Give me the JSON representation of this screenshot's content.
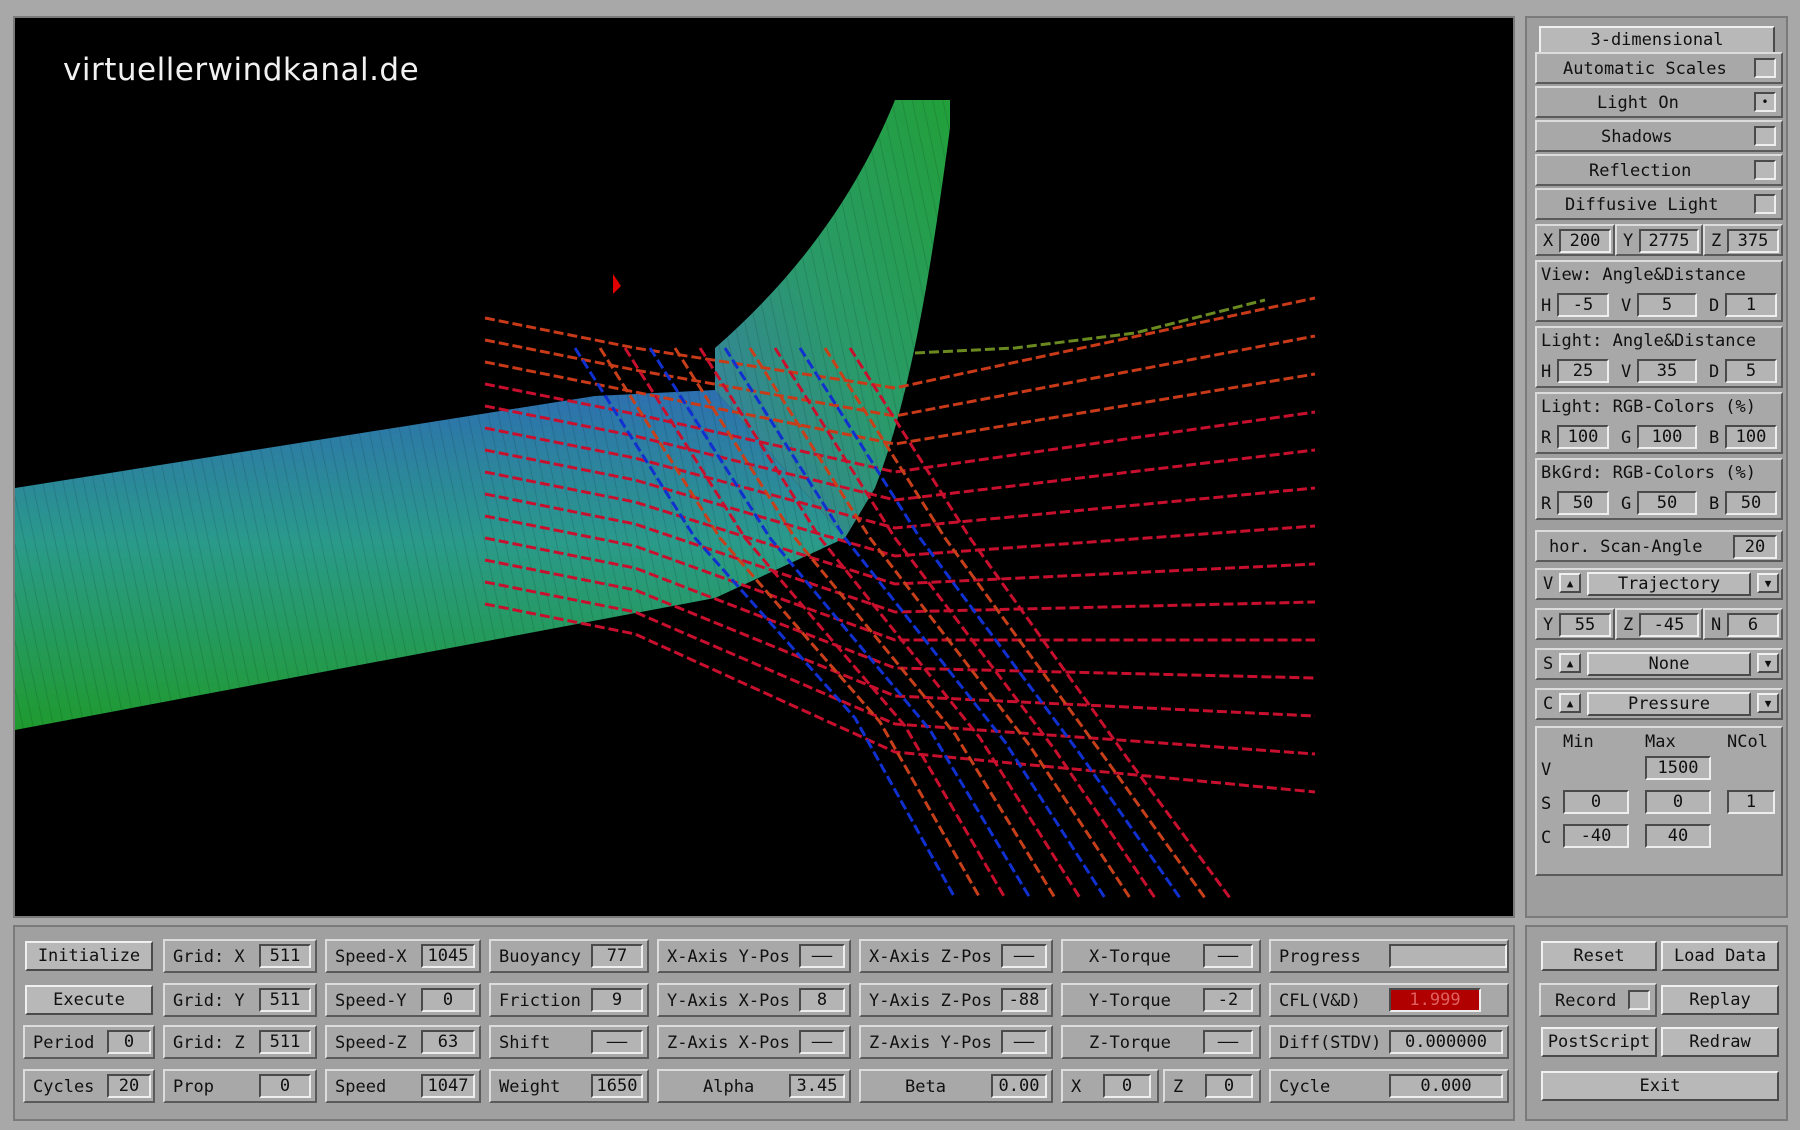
{
  "viewport": {
    "watermark": "virtuellerwindkanal.de"
  },
  "right_panel": {
    "mode_button": "3-dimensional",
    "toggles": [
      {
        "label": "Automatic Scales",
        "checked": false
      },
      {
        "label": "Light On",
        "checked": true
      },
      {
        "label": "Shadows",
        "checked": false
      },
      {
        "label": "Reflection",
        "checked": false
      },
      {
        "label": "Diffusive Light",
        "checked": false
      }
    ],
    "position": {
      "x_label": "X",
      "x": "200",
      "y_label": "Y",
      "y": "2775",
      "z_label": "Z",
      "z": "375"
    },
    "view": {
      "title": "View:  Angle&Distance",
      "h_label": "H",
      "h": "-5",
      "v_label": "V",
      "v": "5",
      "d_label": "D",
      "d": "1"
    },
    "light_angle": {
      "title": "Light: Angle&Distance",
      "h_label": "H",
      "h": "25",
      "v_label": "V",
      "v": "35",
      "d_label": "D",
      "d": "5"
    },
    "light_rgb": {
      "title": "Light: RGB-Colors (%)",
      "r_label": "R",
      "r": "100",
      "g_label": "G",
      "g": "100",
      "b_label": "B",
      "b": "100"
    },
    "bkgrd_rgb": {
      "title": "BkGrd: RGB-Colors (%)",
      "r_label": "R",
      "r": "50",
      "g_label": "G",
      "g": "50",
      "b_label": "B",
      "b": "50"
    },
    "scan_angle": {
      "label": "hor. Scan-Angle",
      "value": "20"
    },
    "v_select": {
      "label": "V",
      "value": "Trajectory"
    },
    "yzn": {
      "y_label": "Y",
      "y": "55",
      "z_label": "Z",
      "z": "-45",
      "n_label": "N",
      "n": "6"
    },
    "s_select": {
      "label": "S",
      "value": "None"
    },
    "c_select": {
      "label": "C",
      "value": "Pressure"
    },
    "scales": {
      "min_header": "Min",
      "max_header": "Max",
      "ncol_header": "NCol",
      "v_label": "V",
      "v_max": "1500",
      "s_label": "S",
      "s_min": "0",
      "s_max": "0",
      "s_ncol": "1",
      "c_label": "C",
      "c_min": "-40",
      "c_max": "40"
    }
  },
  "bottom_panel": {
    "initialize": "Initialize",
    "execute": "Execute",
    "period": {
      "label": "Period",
      "value": "0"
    },
    "cycles": {
      "label": "Cycles",
      "value": "20"
    },
    "grid_x": {
      "label": "Grid: X",
      "value": "511"
    },
    "grid_y": {
      "label": "Grid: Y",
      "value": "511"
    },
    "grid_z": {
      "label": "Grid: Z",
      "value": "511"
    },
    "prop": {
      "label": "Prop",
      "value": "0"
    },
    "speed_x": {
      "label": "Speed-X",
      "value": "1045"
    },
    "speed_y": {
      "label": "Speed-Y",
      "value": "0"
    },
    "speed_z": {
      "label": "Speed-Z",
      "value": "63"
    },
    "speed": {
      "label": "Speed",
      "value": "1047"
    },
    "buoyancy": {
      "label": "Buoyancy",
      "value": "77"
    },
    "friction": {
      "label": "Friction",
      "value": "9"
    },
    "shift": {
      "label": "Shift",
      "value": "——"
    },
    "weight": {
      "label": "Weight",
      "value": "1650"
    },
    "x_axis_y_pos": {
      "label": "X-Axis Y-Pos",
      "value": "——"
    },
    "y_axis_x_pos": {
      "label": "Y-Axis X-Pos",
      "value": "8"
    },
    "z_axis_x_pos": {
      "label": "Z-Axis X-Pos",
      "value": "——"
    },
    "alpha": {
      "label": "Alpha",
      "value": "3.45"
    },
    "x_axis_z_pos": {
      "label": "X-Axis Z-Pos",
      "value": "——"
    },
    "y_axis_z_pos": {
      "label": "Y-Axis Z-Pos",
      "value": "-88"
    },
    "z_axis_y_pos": {
      "label": "Z-Axis Y-Pos",
      "value": "——"
    },
    "beta": {
      "label": "Beta",
      "value": "0.00"
    },
    "x_torque": {
      "label": "X-Torque",
      "value": "——"
    },
    "y_torque": {
      "label": "Y-Torque",
      "value": "-2"
    },
    "z_torque": {
      "label": "Z-Torque",
      "value": "——"
    },
    "x_small": {
      "label": "X",
      "value": "0"
    },
    "z_small": {
      "label": "Z",
      "value": "0"
    },
    "progress": {
      "label": "Progress",
      "value": ""
    },
    "cfl": {
      "label": "CFL(V&D)",
      "value": "1.999",
      "color": "#b00000"
    },
    "diff": {
      "label": "Diff(STDV)",
      "value": "0.000000"
    },
    "cycle": {
      "label": "Cycle",
      "value": "0.000"
    }
  },
  "controls": {
    "reset": "Reset",
    "load_data": "Load Data",
    "record": "Record",
    "replay": "Replay",
    "postscript": "PostScript",
    "redraw": "Redraw",
    "exit": "Exit"
  },
  "colors": {
    "panel": "#a0a0a0",
    "viewport_bg": "#000000",
    "wing_green": "#2aa83a",
    "wing_blue": "#2a7aa0",
    "streak_red": "#c8102e",
    "streak_blue": "#1030d0"
  }
}
